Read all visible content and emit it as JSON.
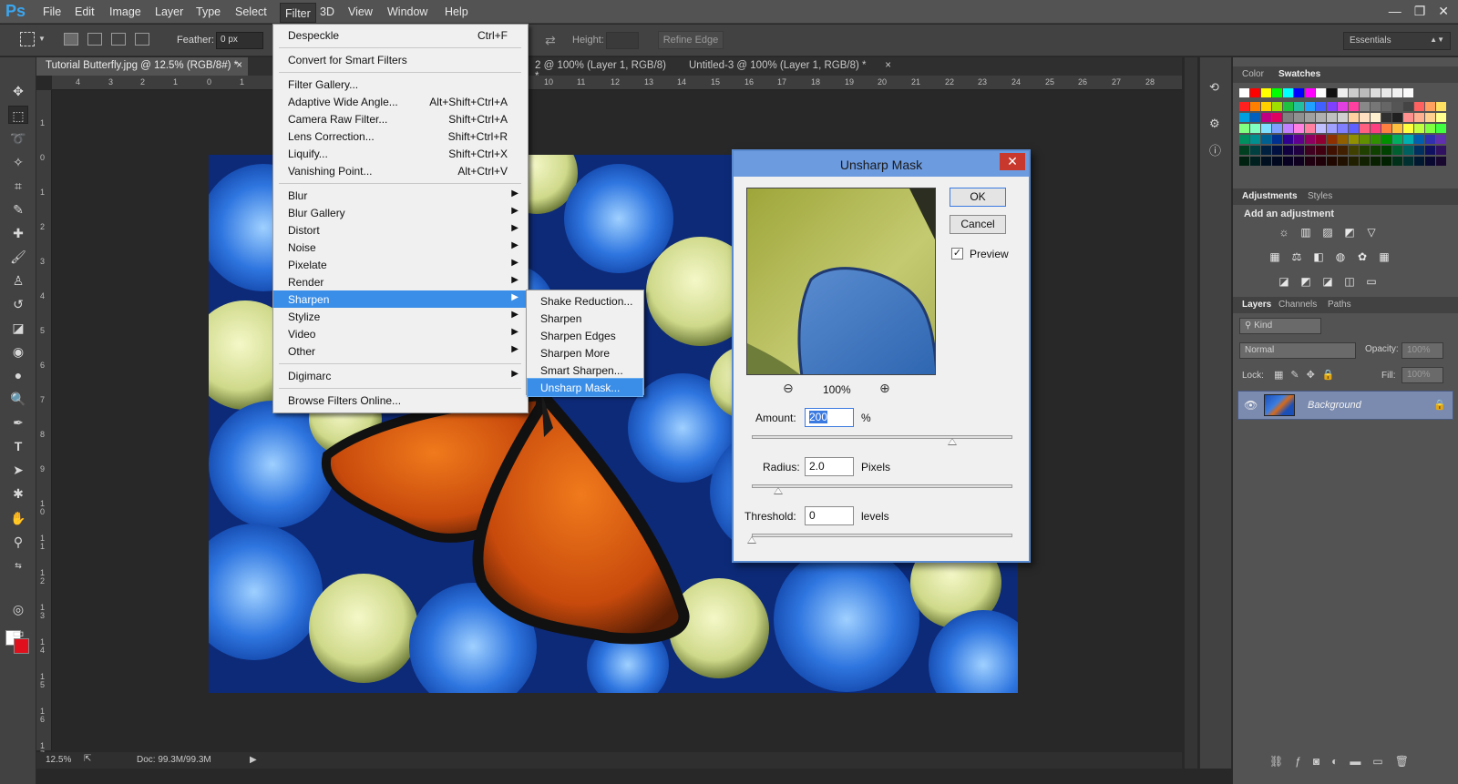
{
  "app": {
    "logo": "Ps",
    "window_controls": [
      "—",
      "❐",
      "✕"
    ]
  },
  "menubar": [
    "File",
    "Edit",
    "Image",
    "Layer",
    "Type",
    "Select",
    "Filter",
    "3D",
    "View",
    "Window",
    "Help"
  ],
  "options": {
    "feather_label": "Feather:",
    "feather_value": "0 px",
    "height_label": "Height:",
    "refine_edge": "Refine Edge",
    "workspace": "Essentials"
  },
  "tabs": [
    {
      "label": "Tutorial Butterfly.jpg @ 12.5% (RGB/8#) *",
      "active": true
    },
    {
      "label": "2 @ 100% (Layer 1, RGB/8) *",
      "active": false
    },
    {
      "label": "Untitled-3 @ 100% (Layer 1, RGB/8) *",
      "active": false
    }
  ],
  "ruler_top": [
    "4",
    "3",
    "2",
    "1",
    "0",
    "1",
    "10",
    "11",
    "12",
    "13",
    "14",
    "15",
    "16",
    "17",
    "18",
    "19",
    "20",
    "21",
    "22",
    "23",
    "24",
    "25",
    "26",
    "27",
    "28"
  ],
  "ruler_left": [
    "1",
    "0",
    "1",
    "2",
    "3",
    "4",
    "5",
    "6",
    "7",
    "8",
    "9",
    "1 0",
    "1 1",
    "1 2",
    "1 3",
    "1 4",
    "1 5",
    "1 6",
    "1 7"
  ],
  "filter_menu": [
    {
      "label": "Despeckle",
      "shortcut": "Ctrl+F"
    },
    {
      "sep": true
    },
    {
      "label": "Convert for Smart Filters"
    },
    {
      "sep": true
    },
    {
      "label": "Filter Gallery..."
    },
    {
      "label": "Adaptive Wide Angle...",
      "shortcut": "Alt+Shift+Ctrl+A"
    },
    {
      "label": "Camera Raw Filter...",
      "shortcut": "Shift+Ctrl+A"
    },
    {
      "label": "Lens Correction...",
      "shortcut": "Shift+Ctrl+R"
    },
    {
      "label": "Liquify...",
      "shortcut": "Shift+Ctrl+X"
    },
    {
      "label": "Vanishing Point...",
      "shortcut": "Alt+Ctrl+V"
    },
    {
      "sep": true
    },
    {
      "label": "Blur",
      "submenu": true
    },
    {
      "label": "Blur Gallery",
      "submenu": true
    },
    {
      "label": "Distort",
      "submenu": true
    },
    {
      "label": "Noise",
      "submenu": true
    },
    {
      "label": "Pixelate",
      "submenu": true
    },
    {
      "label": "Render",
      "submenu": true
    },
    {
      "label": "Sharpen",
      "submenu": true,
      "highlighted": true
    },
    {
      "label": "Stylize",
      "submenu": true
    },
    {
      "label": "Video",
      "submenu": true
    },
    {
      "label": "Other",
      "submenu": true
    },
    {
      "sep": true
    },
    {
      "label": "Digimarc",
      "submenu": true
    },
    {
      "sep": true
    },
    {
      "label": "Browse Filters Online..."
    }
  ],
  "sharpen_submenu": [
    {
      "label": "Shake Reduction..."
    },
    {
      "label": "Sharpen"
    },
    {
      "label": "Sharpen Edges"
    },
    {
      "label": "Sharpen More"
    },
    {
      "label": "Smart Sharpen..."
    },
    {
      "label": "Unsharp Mask...",
      "highlighted": true
    }
  ],
  "dialog": {
    "title": "Unsharp Mask",
    "close": "✕",
    "ok": "OK",
    "cancel": "Cancel",
    "preview_label": "Preview",
    "preview_checked": true,
    "zoom": "100%",
    "amount_label": "Amount:",
    "amount_value": "200",
    "amount_unit": "%",
    "amount_slider": 0.77,
    "radius_label": "Radius:",
    "radius_value": "2.0",
    "radius_unit": "Pixels",
    "radius_slider": 0.1,
    "threshold_label": "Threshold:",
    "threshold_value": "0",
    "threshold_unit": "levels",
    "threshold_slider": 0.0
  },
  "status": {
    "zoom": "12.5%",
    "doc": "Doc: 99.3M/99.3M"
  },
  "panels": {
    "color_tabs": [
      "Color",
      "Swatches"
    ],
    "adj_tabs": [
      "Adjustments",
      "Styles"
    ],
    "adj_title": "Add an adjustment",
    "layers_tabs": [
      "Layers",
      "Channels",
      "Paths"
    ],
    "kind": "Kind",
    "blend_mode": "Normal",
    "opacity_label": "Opacity:",
    "opacity_value": "100%",
    "lock_label": "Lock:",
    "fill_label": "Fill:",
    "fill_value": "100%",
    "layer_name": "Background"
  },
  "colors": {
    "accent": "#3a8ee8",
    "dialog_title": "#6c9be0",
    "close": "#c9382d"
  }
}
